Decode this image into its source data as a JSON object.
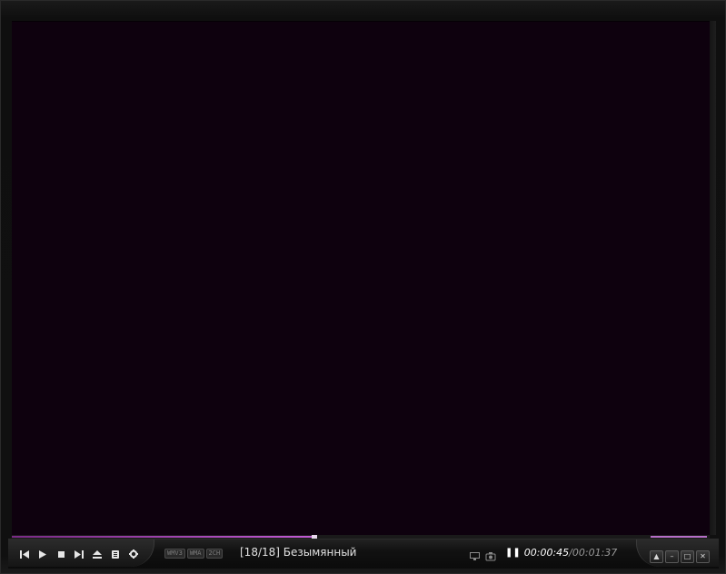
{
  "player": {
    "progress_fraction": 0.43,
    "volume_fraction": 0.8,
    "accent_color": "#c25ad4",
    "video_background": "#0e010e"
  },
  "controls": {
    "icons": [
      "previous-icon",
      "play-icon",
      "stop-icon",
      "next-icon",
      "eject-icon",
      "playlist-icon",
      "settings-icon"
    ]
  },
  "badges": [
    "WMV3",
    "WMA",
    "2CH"
  ],
  "track": {
    "text": "[18/18] Безымянный"
  },
  "time": {
    "current": "00:00:45",
    "separator": "/",
    "total": "00:01:37"
  },
  "window_buttons": {
    "icons": [
      "ontop-icon",
      "minimize-icon",
      "maximize-icon",
      "close-icon"
    ],
    "labels": [
      "▲",
      "–",
      "□",
      "✕"
    ]
  }
}
